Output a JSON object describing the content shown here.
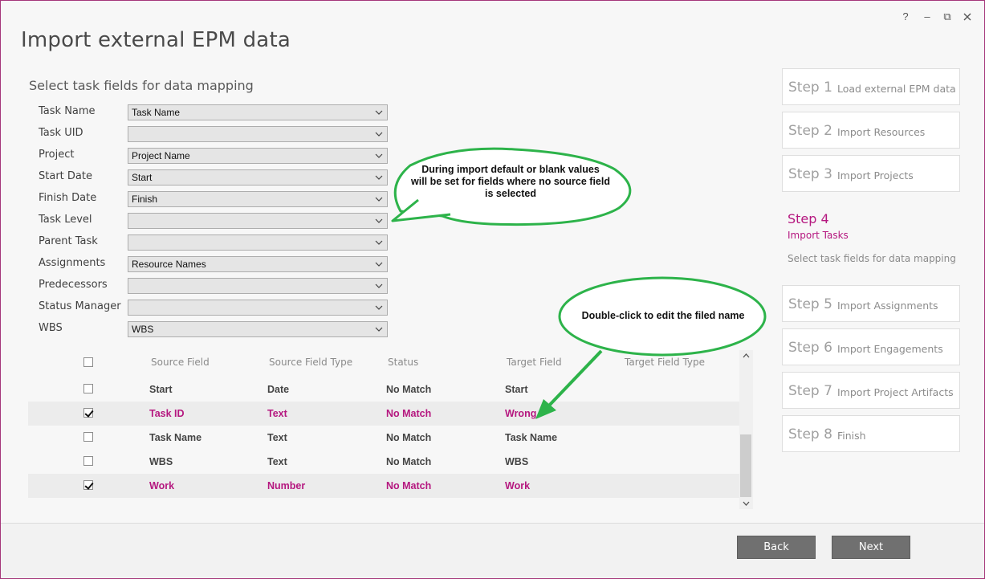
{
  "window": {
    "title": "Import external EPM data",
    "help_glyph": "?",
    "minimize_glyph": "–",
    "restore_glyph": "⧉"
  },
  "mapping": {
    "heading": "Select task fields for data mapping",
    "fields": [
      {
        "label": "Task Name",
        "value": "Task Name"
      },
      {
        "label": "Task UID",
        "value": ""
      },
      {
        "label": "Project",
        "value": "Project Name"
      },
      {
        "label": "Start Date",
        "value": "Start"
      },
      {
        "label": "Finish Date",
        "value": "Finish"
      },
      {
        "label": "Task Level",
        "value": ""
      },
      {
        "label": "Parent Task",
        "value": ""
      },
      {
        "label": "Assignments",
        "value": "Resource Names"
      },
      {
        "label": "Predecessors",
        "value": ""
      },
      {
        "label": "Status Manager",
        "value": ""
      },
      {
        "label": "WBS",
        "value": "WBS"
      }
    ]
  },
  "table": {
    "columns": [
      "Source Field",
      "Source Field Type",
      "Status",
      "Target Field",
      "Target Field Type"
    ],
    "rows": [
      {
        "checked": false,
        "source": "Start",
        "type": "Date",
        "status": "No Match",
        "target": "Start",
        "target_type": ""
      },
      {
        "checked": true,
        "source": "Task ID",
        "type": "Text",
        "status": "No Match",
        "target": "Wrong",
        "target_type": ""
      },
      {
        "checked": false,
        "source": "Task Name",
        "type": "Text",
        "status": "No Match",
        "target": "Task Name",
        "target_type": ""
      },
      {
        "checked": false,
        "source": "WBS",
        "type": "Text",
        "status": "No Match",
        "target": "WBS",
        "target_type": ""
      },
      {
        "checked": true,
        "source": "Work",
        "type": "Number",
        "status": "No Match",
        "target": "Work",
        "target_type": ""
      }
    ]
  },
  "steps": {
    "items": [
      {
        "num": "Step 1",
        "name": "Load external EPM data"
      },
      {
        "num": "Step 2",
        "name": "Import Resources"
      },
      {
        "num": "Step 3",
        "name": "Import Projects"
      },
      {
        "num": "Step 5",
        "name": "Import Assignments"
      },
      {
        "num": "Step 6",
        "name": "Import Engagements"
      },
      {
        "num": "Step 7",
        "name": "Import Project Artifacts"
      },
      {
        "num": "Step 8",
        "name": "Finish"
      }
    ],
    "active": {
      "num": "Step 4",
      "name": "Import Tasks",
      "desc": "Select task fields for data mapping"
    }
  },
  "callouts": {
    "blank_values_line1": "During import default or blank values",
    "blank_values_line2": "will be set for fields where no source field",
    "blank_values_line3": "is selected",
    "double_click": "Double-click to edit the filed name"
  },
  "footer": {
    "back_label": "Back",
    "next_label": "Next"
  },
  "colors": {
    "accent": "#b5177f",
    "callout_border": "#2db34a",
    "button": "#707070"
  }
}
